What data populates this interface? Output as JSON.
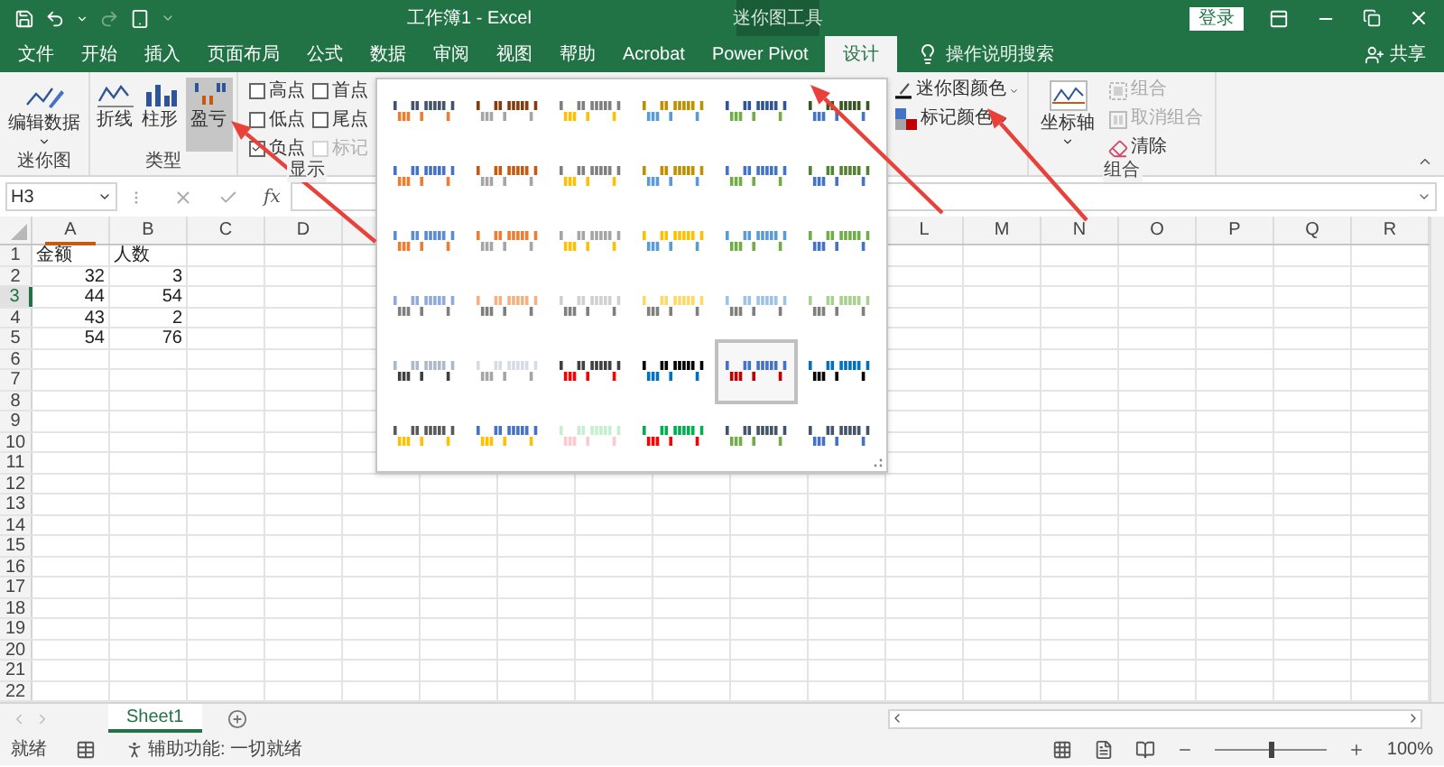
{
  "window": {
    "title": "工作簿1  -  Excel",
    "contextual_tab_group": "迷你图工具",
    "sign_in": "登录",
    "share": "共享"
  },
  "tabs": [
    {
      "label": "文件",
      "selected": false
    },
    {
      "label": "开始",
      "selected": false
    },
    {
      "label": "插入",
      "selected": false
    },
    {
      "label": "页面布局",
      "selected": false
    },
    {
      "label": "公式",
      "selected": false
    },
    {
      "label": "数据",
      "selected": false
    },
    {
      "label": "审阅",
      "selected": false
    },
    {
      "label": "视图",
      "selected": false
    },
    {
      "label": "帮助",
      "selected": false
    },
    {
      "label": "Acrobat",
      "selected": false
    },
    {
      "label": "Power Pivot",
      "selected": false
    },
    {
      "label": "设计",
      "selected": true
    }
  ],
  "tell_me": {
    "placeholder": "操作说明搜索"
  },
  "ribbon": {
    "sparkline_group": {
      "button": "编辑数据",
      "label": "迷你图"
    },
    "type_group": {
      "label": "类型",
      "buttons": [
        {
          "label": "折线",
          "kind": "line",
          "selected": false
        },
        {
          "label": "柱形",
          "kind": "column",
          "selected": false
        },
        {
          "label": "盈亏",
          "kind": "winloss",
          "selected": true
        }
      ]
    },
    "show_group": {
      "label": "显示",
      "options": [
        {
          "label": "高点",
          "checked": false,
          "disabled": false
        },
        {
          "label": "首点",
          "checked": false,
          "disabled": false
        },
        {
          "label": "低点",
          "checked": false,
          "disabled": false
        },
        {
          "label": "尾点",
          "checked": false,
          "disabled": false
        },
        {
          "label": "负点",
          "checked": true,
          "disabled": false
        },
        {
          "label": "标记",
          "checked": false,
          "disabled": true
        }
      ]
    },
    "color_buttons": [
      {
        "label": "迷你图颜色",
        "kind": "sparkline_color"
      },
      {
        "label": "标记颜色",
        "kind": "marker_color"
      }
    ],
    "axis_button": "坐标轴",
    "group_buttons": [
      {
        "label": "组合",
        "kind": "group",
        "disabled": true
      },
      {
        "label": "取消组合",
        "kind": "ungroup",
        "disabled": true
      },
      {
        "label": "清除",
        "kind": "clear",
        "disabled": false
      }
    ],
    "group_label": "组合"
  },
  "formula_bar": {
    "name_box": "H3",
    "function_label": "fx"
  },
  "style_gallery": [
    {
      "color": "#44546a",
      "selected": false
    },
    {
      "color": "#843c0c",
      "selected": false
    },
    {
      "color": "#7f7f7f",
      "selected": false
    },
    {
      "color": "#bf8f00",
      "selected": false
    },
    {
      "color": "#2f5597",
      "selected": false
    },
    {
      "color": "#375623",
      "selected": false
    },
    {
      "color": "#4472c4",
      "selected": false
    },
    {
      "color": "#c55a11",
      "selected": false
    },
    {
      "color": "#7f7f7f",
      "selected": false
    },
    {
      "color": "#bf9000",
      "selected": false
    },
    {
      "color": "#4472c4",
      "selected": false
    },
    {
      "color": "#548235",
      "selected": false
    },
    {
      "color": "#5b8bd5",
      "selected": false
    },
    {
      "color": "#ed7d31",
      "selected": false
    },
    {
      "color": "#a5a5a5",
      "selected": false
    },
    {
      "color": "#ffc000",
      "selected": false
    },
    {
      "color": "#5b9bd5",
      "selected": false
    },
    {
      "color": "#70ad47",
      "selected": false
    },
    {
      "color": "#8faadc",
      "selected": false
    },
    {
      "color": "#f4b183",
      "selected": false
    },
    {
      "color": "#d0d0d0",
      "selected": false
    },
    {
      "color": "#ffd966",
      "selected": false
    },
    {
      "color": "#9dc3e6",
      "selected": false
    },
    {
      "color": "#a9d18e",
      "selected": false
    },
    {
      "color": "#adb9ca",
      "selected": false
    },
    {
      "color": "#d6dce5",
      "selected": false
    },
    {
      "color": "#404040",
      "selected": false
    },
    {
      "color": "#000000",
      "selected": false
    },
    {
      "color": "#4472c4",
      "selected": true
    },
    {
      "color": "#0070c0",
      "selected": false
    },
    {
      "color": "#5a5a5a",
      "selected": false
    },
    {
      "color": "#4472c4",
      "selected": false
    },
    {
      "color": "#c6efce",
      "selected": false
    },
    {
      "color": "#00b050",
      "selected": false
    },
    {
      "color": "#44546a",
      "selected": false
    },
    {
      "color": "#44546a",
      "selected": false
    }
  ],
  "sheet": {
    "columns_left": [
      "A",
      "B",
      "C",
      "D"
    ],
    "columns_right": [
      "L",
      "M",
      "N",
      "O",
      "P",
      "Q",
      "R"
    ],
    "rows": [
      {
        "header": "1",
        "selected": false,
        "cells": [
          {
            "value": "金额",
            "kind": "text"
          },
          {
            "value": "人数",
            "kind": "text"
          }
        ]
      },
      {
        "header": "2",
        "selected": false,
        "cells": [
          {
            "value": "32",
            "kind": "number"
          },
          {
            "value": "3",
            "kind": "number"
          }
        ]
      },
      {
        "header": "3",
        "selected": true,
        "cells": [
          {
            "value": "44",
            "kind": "number"
          },
          {
            "value": "54",
            "kind": "number"
          }
        ]
      },
      {
        "header": "4",
        "selected": false,
        "cells": [
          {
            "value": "43",
            "kind": "number"
          },
          {
            "value": "2",
            "kind": "number"
          }
        ]
      },
      {
        "header": "5",
        "selected": false,
        "cells": [
          {
            "value": "54",
            "kind": "number"
          },
          {
            "value": "76",
            "kind": "number"
          }
        ]
      },
      {
        "header": "6",
        "selected": false
      },
      {
        "header": "7",
        "selected": false
      },
      {
        "header": "8",
        "selected": false
      },
      {
        "header": "9",
        "selected": false
      },
      {
        "header": "10",
        "selected": false
      },
      {
        "header": "11",
        "selected": false
      },
      {
        "header": "12",
        "selected": false
      },
      {
        "header": "13",
        "selected": false
      },
      {
        "header": "14",
        "selected": false
      },
      {
        "header": "15",
        "selected": false
      },
      {
        "header": "16",
        "selected": false
      },
      {
        "header": "17",
        "selected": false
      },
      {
        "header": "18",
        "selected": false
      },
      {
        "header": "19",
        "selected": false
      },
      {
        "header": "20",
        "selected": false
      },
      {
        "header": "21",
        "selected": false
      },
      {
        "header": "22",
        "selected": false
      }
    ]
  },
  "sheet_tabs": [
    {
      "label": "Sheet1",
      "selected": true
    }
  ],
  "status_bar": {
    "ready": "就绪",
    "accessibility": "辅助功能: 一切就绪",
    "zoom": "100%",
    "zoom_slider": {
      "level": 0.5
    }
  }
}
